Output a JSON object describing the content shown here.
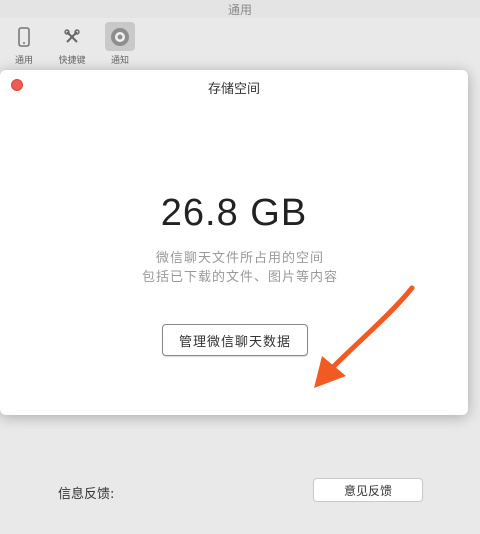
{
  "window": {
    "title": "通用"
  },
  "toolbar": {
    "items": [
      {
        "label": "通用",
        "icon": "phone-icon"
      },
      {
        "label": "快捷键",
        "icon": "shortcut-icon"
      },
      {
        "label": "通知",
        "icon": "notification-icon"
      }
    ]
  },
  "sheet": {
    "title": "存储空间",
    "size": "26.8 GB",
    "description_line1": "微信聊天文件所占用的空间",
    "description_line2": "包括已下载的文件、图片等内容",
    "manage_button": "管理微信聊天数据"
  },
  "feedback": {
    "label": "信息反馈:",
    "button": "意见反馈"
  },
  "colors": {
    "close": "#ee5a55",
    "arrow": "#f15a22"
  }
}
